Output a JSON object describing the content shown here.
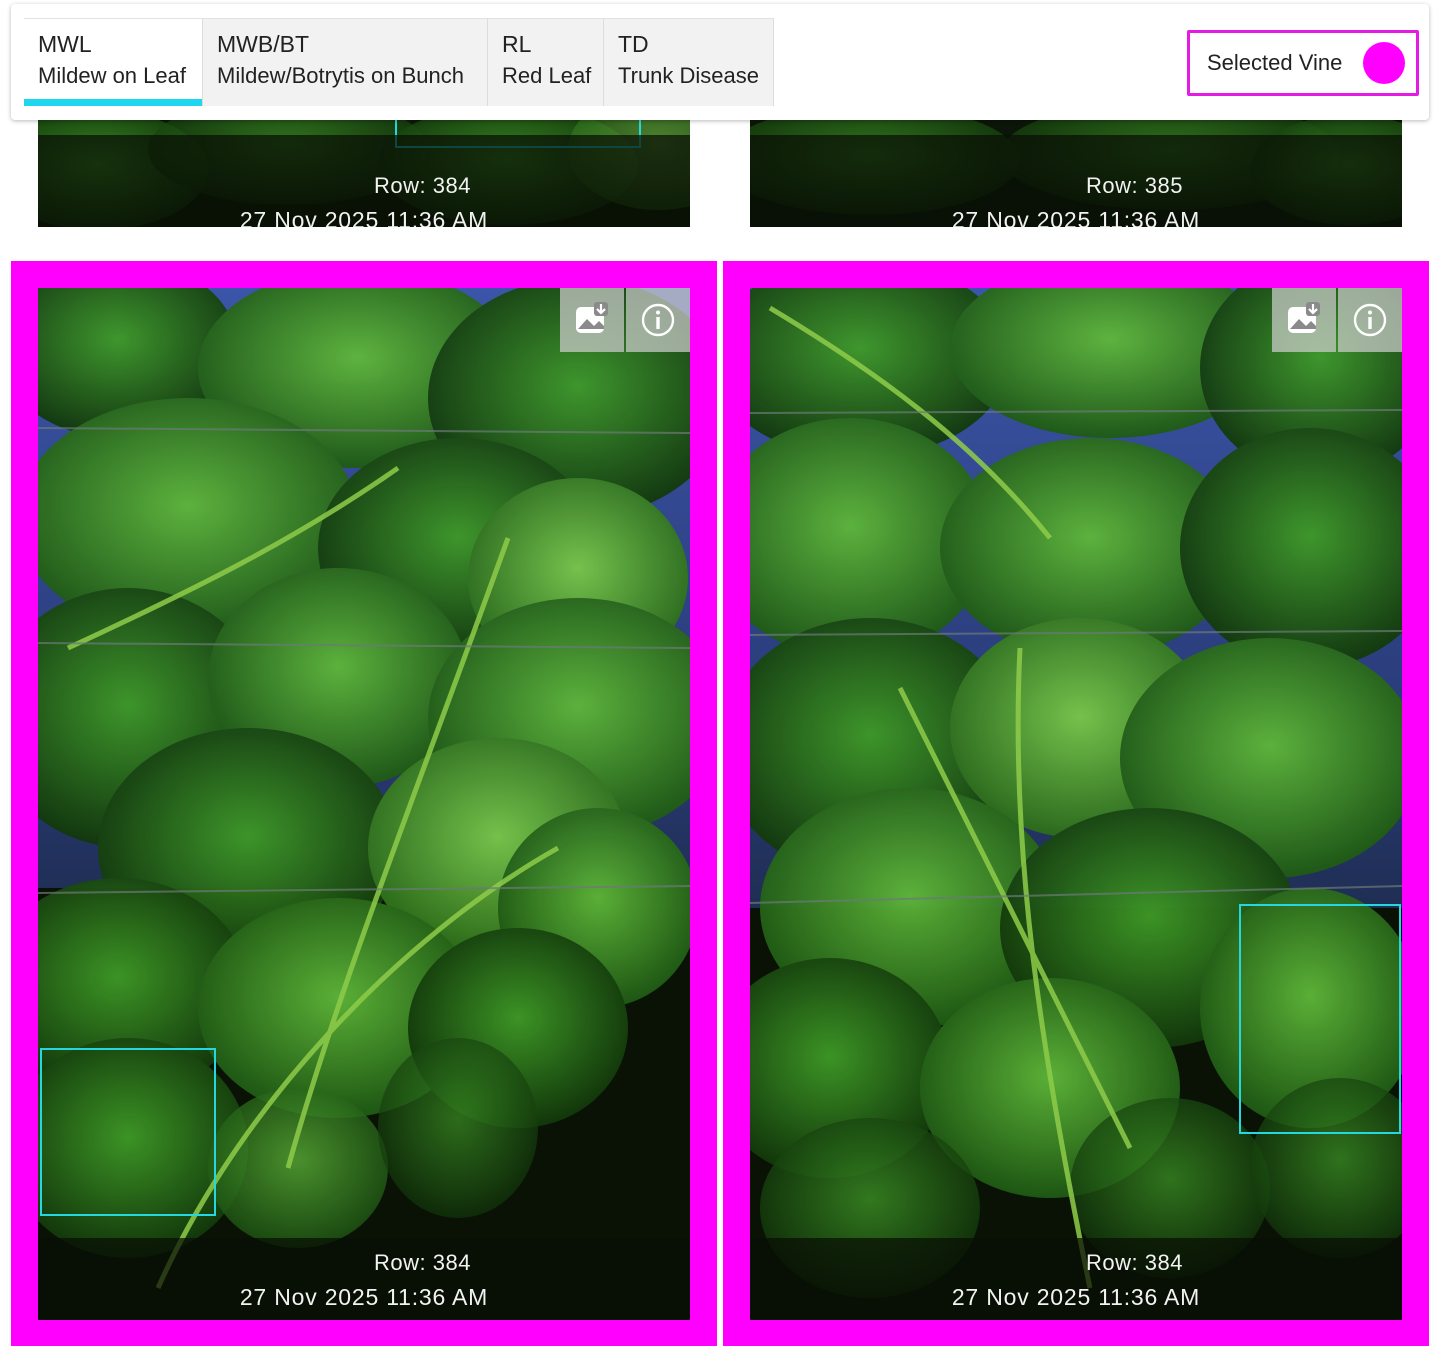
{
  "tabs": [
    {
      "code": "MWL",
      "name": "Mildew on Leaf",
      "active": true
    },
    {
      "code": "MWB/BT",
      "name": "Mildew/Botrytis on Bunch",
      "active": false
    },
    {
      "code": "RL",
      "name": "Red Leaf",
      "active": false
    },
    {
      "code": "TD",
      "name": "Trunk Disease",
      "active": false
    }
  ],
  "legend": {
    "label": "Selected Vine",
    "color": "#ff00ff"
  },
  "colors": {
    "accent_tab": "#1ed7ef",
    "selected_border": "#ff00ff",
    "detection_box": "#25d8e0"
  },
  "cards": [
    {
      "row_label": "Row: 384",
      "timestamp": "27 Nov 2025 11:36 AM",
      "selected": false
    },
    {
      "row_label": "Row: 385",
      "timestamp": "27 Nov 2025 11:36 AM",
      "selected": false
    },
    {
      "row_label": "Row: 384",
      "timestamp": "27 Nov 2025 11:36 AM",
      "selected": true
    },
    {
      "row_label": "Row: 384",
      "timestamp": "27 Nov 2025 11:36 AM",
      "selected": true
    }
  ],
  "icons": {
    "download": "image-download-icon",
    "info": "info-icon"
  }
}
